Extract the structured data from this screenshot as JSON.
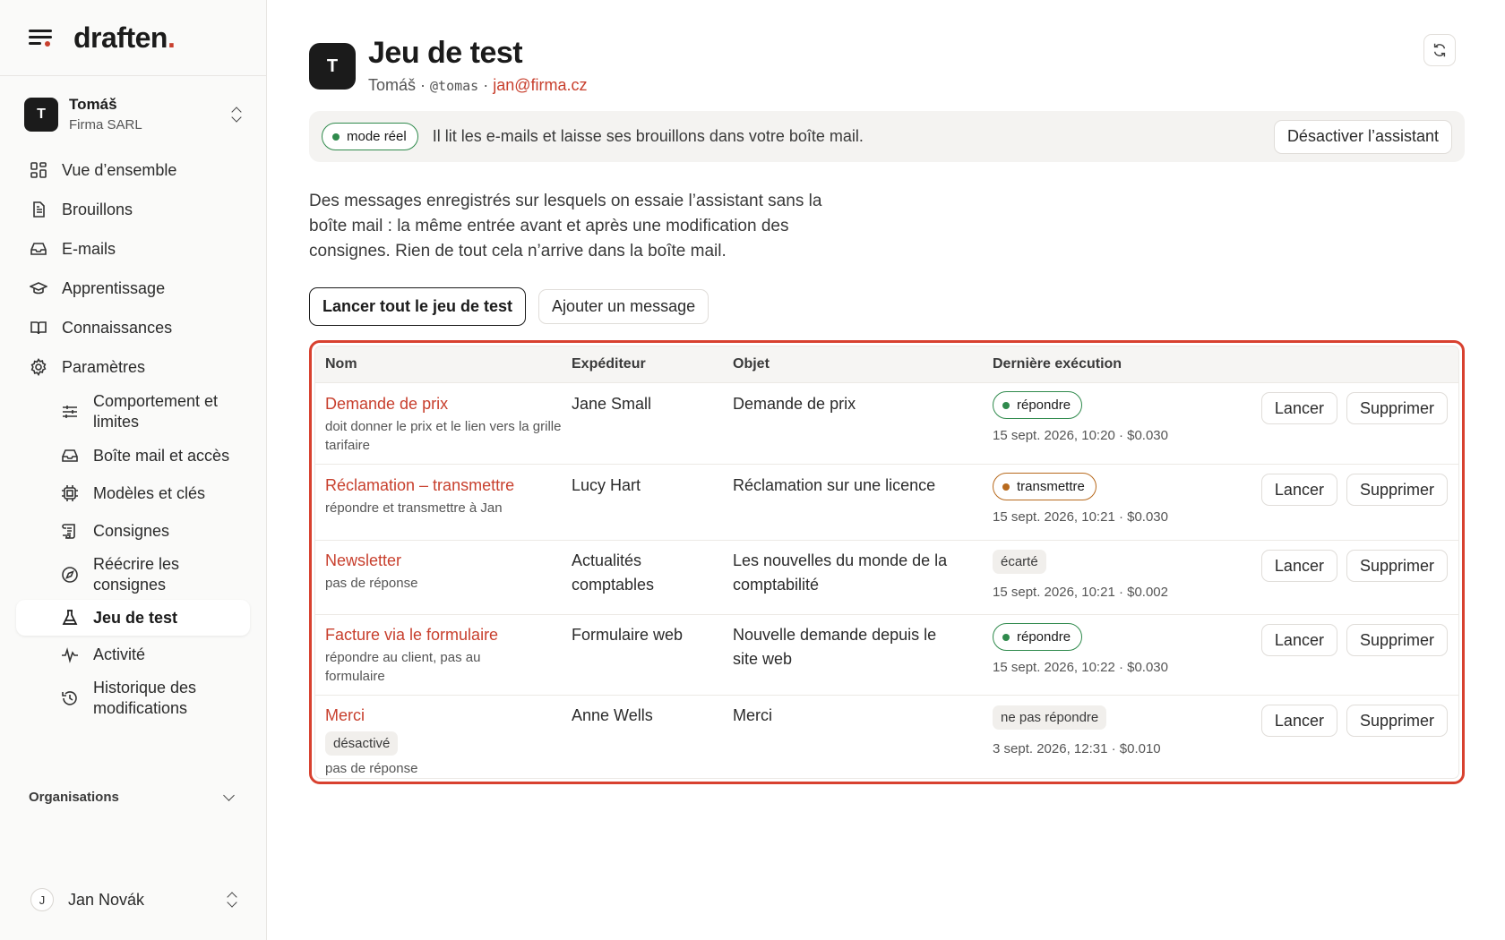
{
  "brand": {
    "name": "draften",
    "dot": "."
  },
  "account": {
    "initial": "T",
    "name": "Tomáš",
    "org": "Firma SARL"
  },
  "nav": [
    {
      "label": "Vue d’ensemble",
      "icon": "grid-icon"
    },
    {
      "label": "Brouillons",
      "icon": "document-icon"
    },
    {
      "label": "E-mails",
      "icon": "inbox-icon"
    },
    {
      "label": "Apprentissage",
      "icon": "graduation-cap-icon"
    },
    {
      "label": "Connaissances",
      "icon": "book-icon"
    },
    {
      "label": "Paramètres",
      "icon": "gear-icon"
    }
  ],
  "subnav": [
    {
      "label": "Comportement et limites",
      "icon": "sliders-icon"
    },
    {
      "label": "Boîte mail et accès",
      "icon": "inbox-icon"
    },
    {
      "label": "Modèles et clés",
      "icon": "chip-icon"
    },
    {
      "label": "Consignes",
      "icon": "scroll-icon"
    },
    {
      "label": "Réécrire les consignes",
      "icon": "compass-icon"
    },
    {
      "label": "Jeu de test",
      "icon": "flask-icon"
    },
    {
      "label": "Activité",
      "icon": "pulse-icon"
    },
    {
      "label": "Historique des modifications",
      "icon": "history-icon"
    }
  ],
  "organisations_label": "Organisations",
  "user": {
    "initial": "J",
    "name": "Jan Novák"
  },
  "header": {
    "initial": "T",
    "title": "Jeu de test",
    "name": "Tomáš",
    "sep": " · ",
    "handle": "@tomas",
    "email": "jan@firma.cz"
  },
  "banner": {
    "mode": "mode réel",
    "message": "Il lit les e-mails et laisse ses brouillons dans votre boîte mail.",
    "button": "Désactiver l’assistant"
  },
  "intro": "Des messages enregistrés sur lesquels on essaie l’assistant sans la boîte mail : la même entrée avant et après une modification des consignes. Rien de tout cela n’arrive dans la boîte mail.",
  "actions": {
    "run_all": "Lancer tout le jeu de test",
    "add": "Ajouter un message"
  },
  "table": {
    "headers": {
      "nom": "Nom",
      "exp": "Expéditeur",
      "obj": "Objet",
      "der": "Dernière exécution"
    },
    "run_label": "Lancer",
    "delete_label": "Supprimer",
    "rows": [
      {
        "name": "Demande de prix",
        "desc": "doit donner le prix et le lien vers la grille tarifaire",
        "tag": "",
        "sender": "Jane Small",
        "subject": "Demande de prix",
        "status": "répondre",
        "status_style": "green",
        "ts": "15 sept. 2026, 10:20 · $0.030"
      },
      {
        "name": "Réclamation – transmettre",
        "desc": "répondre et transmettre à Jan",
        "tag": "",
        "sender": "Lucy Hart",
        "subject": "Réclamation sur une licence",
        "status": "transmettre",
        "status_style": "orange",
        "ts": "15 sept. 2026, 10:21 · $0.030"
      },
      {
        "name": "Newsletter",
        "desc": "pas de réponse",
        "tag": "",
        "sender": "Actualités comptables",
        "subject": "Les nouvelles du monde de la comptabilité",
        "status": "écarté",
        "status_style": "gray",
        "ts": "15 sept. 2026, 10:21 · $0.002"
      },
      {
        "name": "Facture via le formulaire",
        "desc": "répondre au client, pas au formulaire",
        "tag": "",
        "sender": "Formulaire web",
        "subject": "Nouvelle demande depuis le site web",
        "status": "répondre",
        "status_style": "green",
        "ts": "15 sept. 2026, 10:22 · $0.030"
      },
      {
        "name": "Merci",
        "desc": "pas de réponse",
        "tag": "désactivé",
        "sender": "Anne Wells",
        "subject": "Merci",
        "status": "ne pas répondre",
        "status_style": "gray",
        "ts": "3 sept. 2026, 12:31 · $0.010"
      }
    ]
  },
  "colors": {
    "accent": "#c8402e",
    "green": "#2f8a4c",
    "orange": "#b86a1d",
    "highlight": "#d8412f"
  }
}
